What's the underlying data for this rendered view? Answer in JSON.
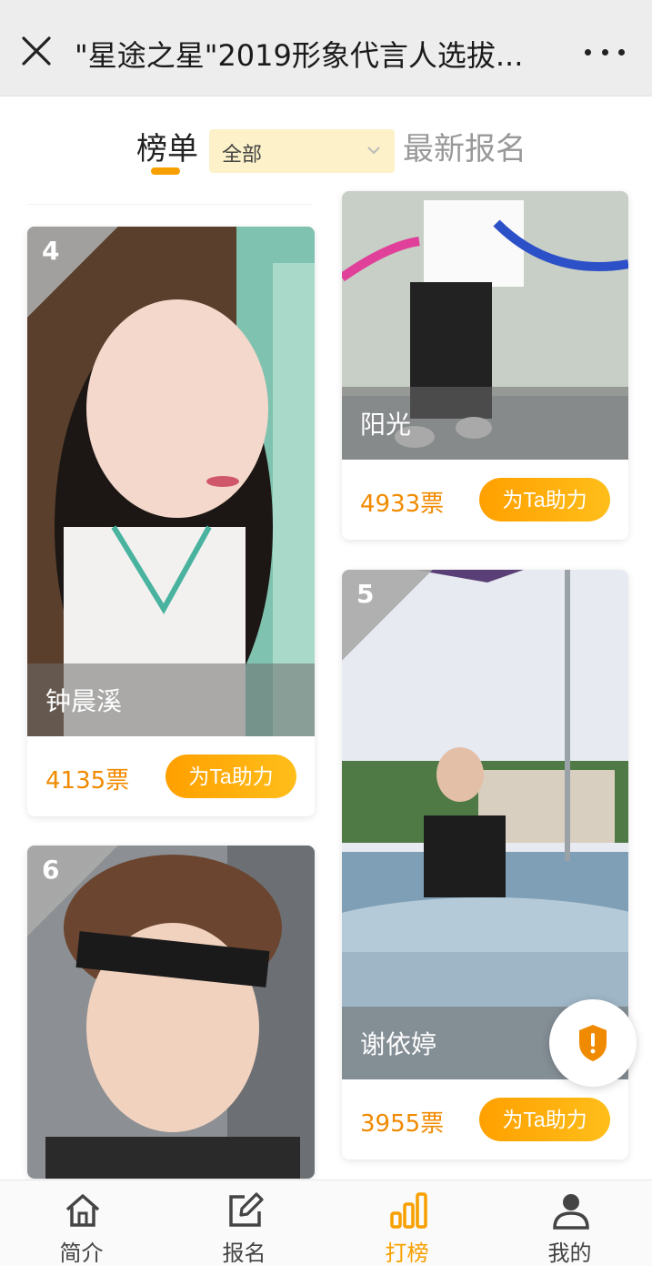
{
  "header": {
    "title": "\"星途之星\"2019形象代言人选拔...",
    "close_icon": "close-icon",
    "more_icon": "more-icon"
  },
  "tabs": {
    "rank_label": "榜单",
    "filter_value": "全部",
    "latest_label": "最新报名"
  },
  "cards": [
    {
      "rank": "4",
      "name": "钟晨溪",
      "votes": "4135票",
      "button": "为Ta助力"
    },
    {
      "rank": "",
      "name": "阳光",
      "votes": "4933票",
      "button": "为Ta助力"
    },
    {
      "rank": "5",
      "name": "谢依婷",
      "votes": "3955票",
      "button": "为Ta助力"
    },
    {
      "rank": "6",
      "name": "",
      "votes": "",
      "button": ""
    }
  ],
  "report_icon": "shield-alert-icon",
  "nav": [
    {
      "label": "简介",
      "icon": "home-icon"
    },
    {
      "label": "报名",
      "icon": "edit-icon"
    },
    {
      "label": "打榜",
      "icon": "bar-chart-icon"
    },
    {
      "label": "我的",
      "icon": "user-icon"
    }
  ],
  "colors": {
    "accent": "#f7a000",
    "vote": "#f08a00",
    "filter_bg": "#fcf1c8"
  }
}
